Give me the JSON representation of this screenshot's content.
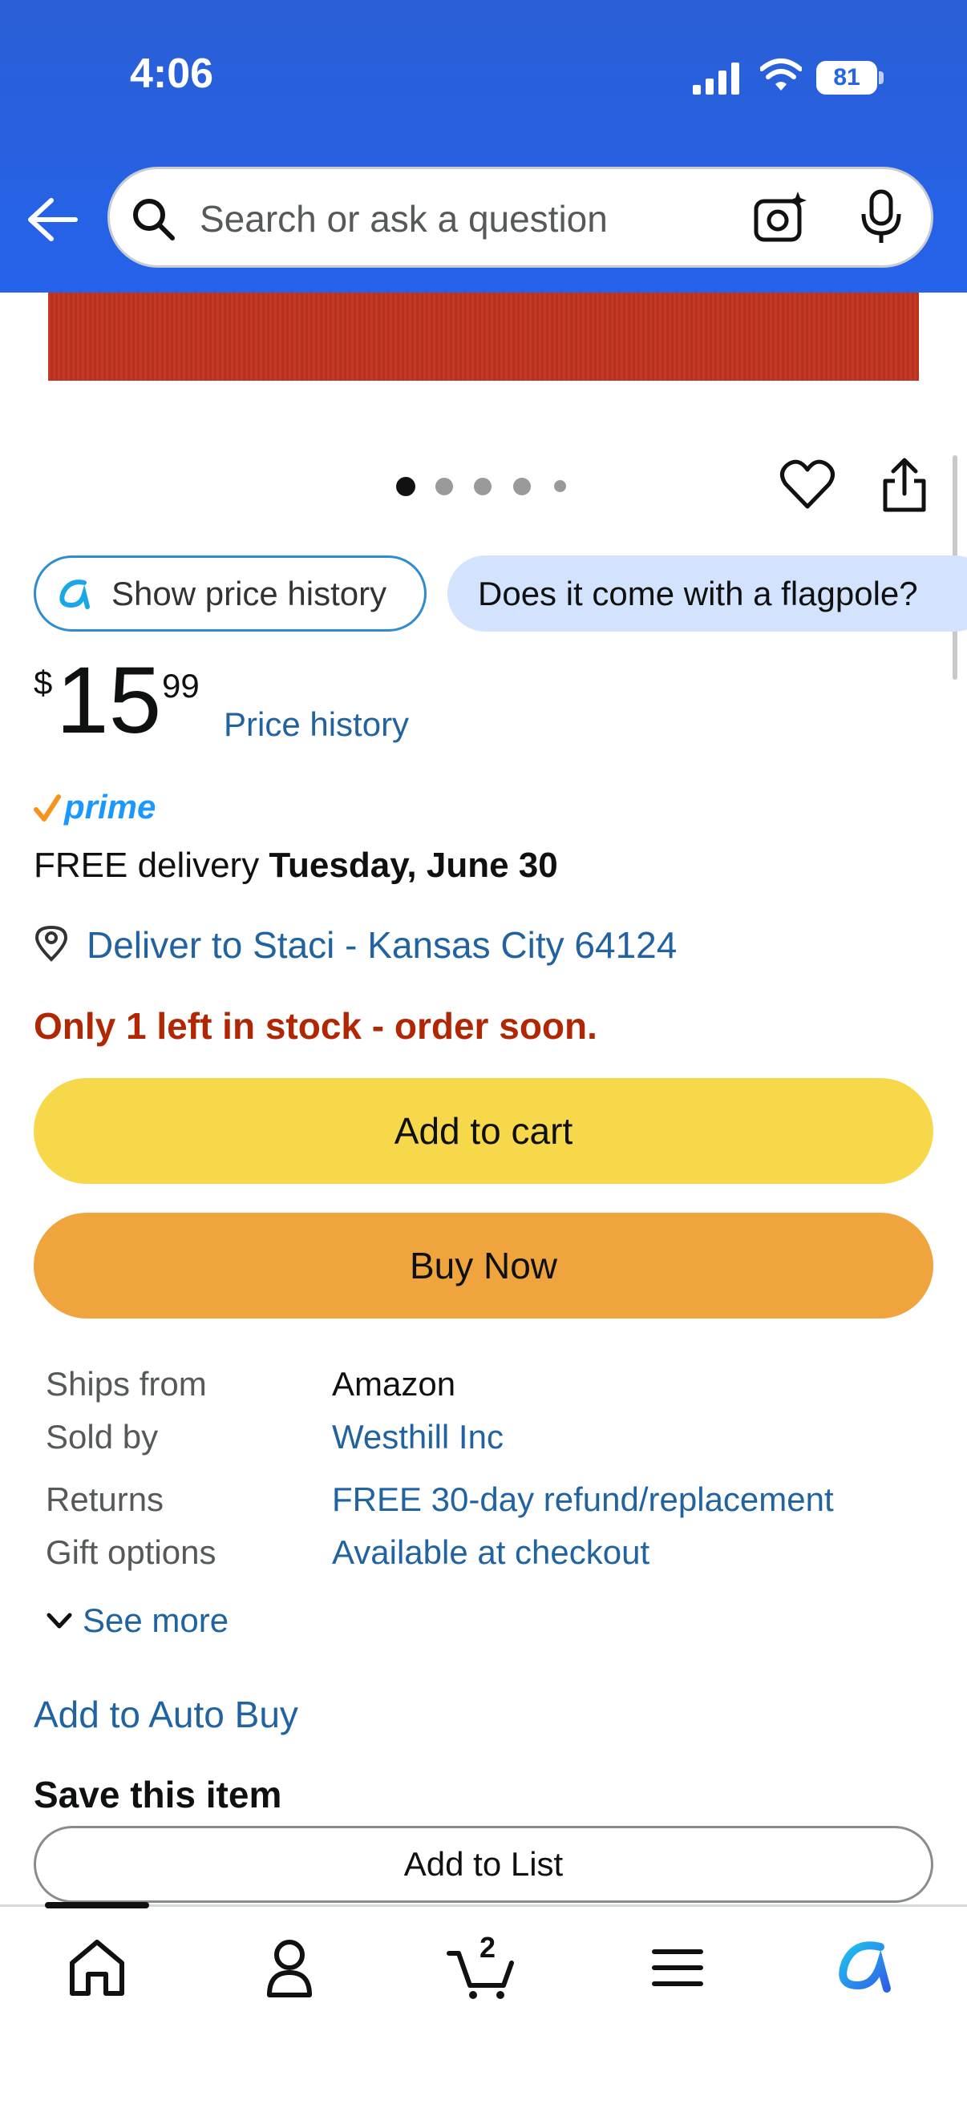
{
  "status_bar": {
    "time": "4:06",
    "battery": "81"
  },
  "search": {
    "placeholder": "Search or ask a question"
  },
  "chips": {
    "price_history": "Show price history",
    "question": "Does it come with a flagpole?"
  },
  "price": {
    "symbol": "$",
    "whole": "15",
    "fraction": "99",
    "history_link": "Price history"
  },
  "prime": {
    "label": "prime"
  },
  "delivery": {
    "prefix": "FREE delivery ",
    "date": "Tuesday, June 30"
  },
  "location": {
    "label": "Deliver to Staci - Kansas City 64124"
  },
  "stock": {
    "message": "Only 1 left in stock - order soon."
  },
  "buttons": {
    "add_to_cart": "Add to cart",
    "buy_now": "Buy Now",
    "add_to_list": "Add to List"
  },
  "details": {
    "rows": [
      {
        "label": "Ships from",
        "value": "Amazon"
      },
      {
        "label": "Sold by",
        "value": "Westhill Inc"
      },
      {
        "label": "Returns",
        "value": "FREE 30-day refund/replacement"
      },
      {
        "label": "Gift options",
        "value": "Available at checkout"
      }
    ],
    "see_more": "See more"
  },
  "auto_buy": "Add to Auto Buy",
  "save_heading": "Save this item",
  "carousel": {
    "count": 5,
    "active": 0
  },
  "nav": {
    "cart_count": "2",
    "icons": [
      "home-icon",
      "account-icon",
      "cart-icon",
      "menu-icon",
      "rufus-icon"
    ]
  },
  "colors": {
    "header": "#2563eb",
    "link": "#2162a1",
    "stock": "#b12704",
    "add_to_cart": "#f7d84a",
    "buy_now": "#f0a43d",
    "chip_question": "#d3e3fd"
  }
}
